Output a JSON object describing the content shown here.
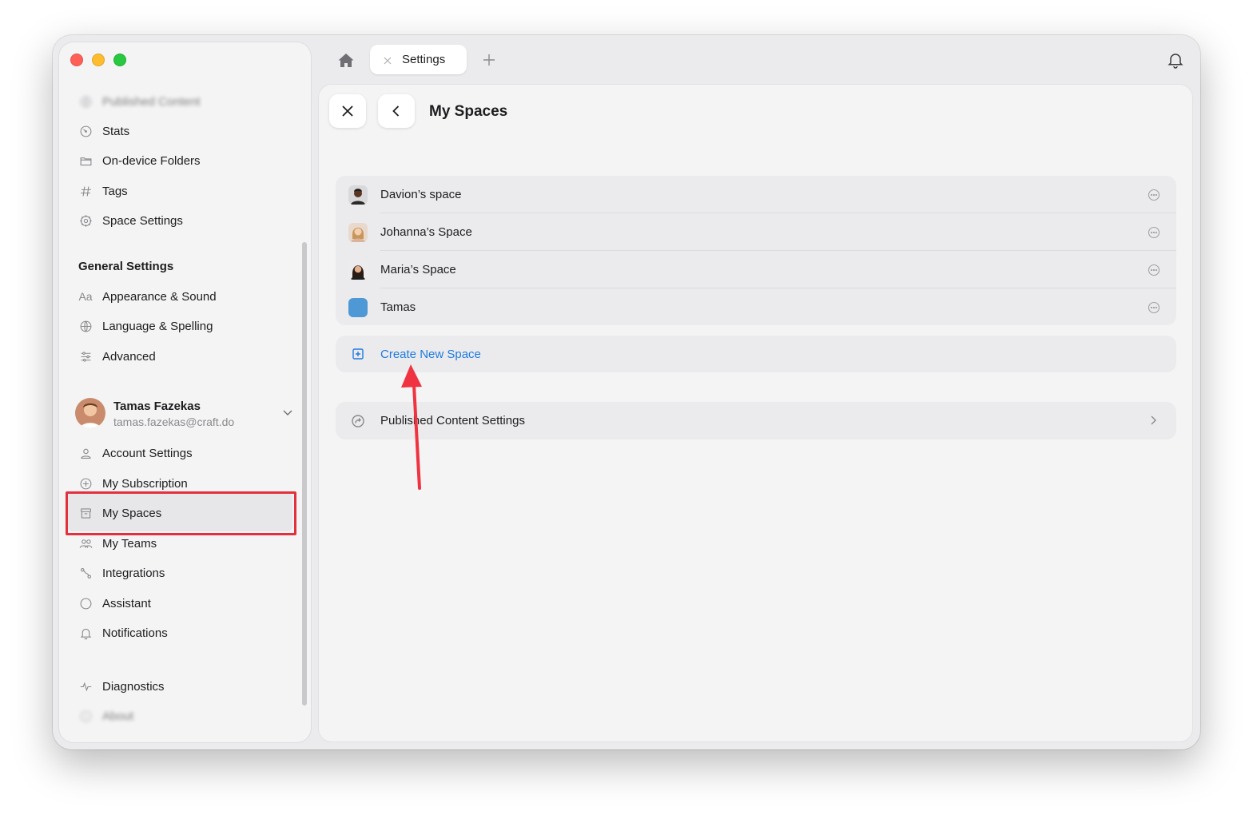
{
  "tabs": {
    "active_label": "Settings"
  },
  "sidebar": {
    "top_items": [
      {
        "label": "Published Content",
        "icon": "globe-icon"
      },
      {
        "label": "Stats",
        "icon": "gauge-icon"
      },
      {
        "label": "On-device Folders",
        "icon": "folder-icon"
      },
      {
        "label": "Tags",
        "icon": "hash-icon"
      },
      {
        "label": "Space Settings",
        "icon": "gear-icon"
      }
    ],
    "general_heading": "General Settings",
    "general_items": [
      {
        "label": "Appearance & Sound",
        "icon": "font-aa-icon"
      },
      {
        "label": "Language & Spelling",
        "icon": "globe-icon"
      },
      {
        "label": "Advanced",
        "icon": "sliders-icon"
      }
    ],
    "user": {
      "name": "Tamas Fazekas",
      "email": "tamas.fazekas@craft.do"
    },
    "account_items": [
      {
        "label": "Account Settings",
        "icon": "person-icon"
      },
      {
        "label": "My Subscription",
        "icon": "plus-circle-icon"
      },
      {
        "label": "My Spaces",
        "icon": "archive-box-icon",
        "selected": true
      },
      {
        "label": "My Teams",
        "icon": "people-icon"
      },
      {
        "label": "Integrations",
        "icon": "link-icon"
      },
      {
        "label": "Assistant",
        "icon": "circle-icon"
      },
      {
        "label": "Notifications",
        "icon": "bell-icon"
      }
    ],
    "bottom_items": [
      {
        "label": "Diagnostics",
        "icon": "pulse-icon"
      },
      {
        "label": "About",
        "icon": "info-icon"
      }
    ]
  },
  "main": {
    "title": "My Spaces",
    "spaces": [
      {
        "label": "Davion’s space"
      },
      {
        "label": "Johanna’s Space"
      },
      {
        "label": "Maria’s Space"
      },
      {
        "label": "Tamas"
      }
    ],
    "create_label": "Create New Space",
    "published_settings_label": "Published Content Settings"
  },
  "colors": {
    "accent_link": "#1f7ae0",
    "highlight_box": "#e3303f",
    "annotation_arrow": "#ef3340",
    "tamas_space_color": "#4e98d6"
  }
}
